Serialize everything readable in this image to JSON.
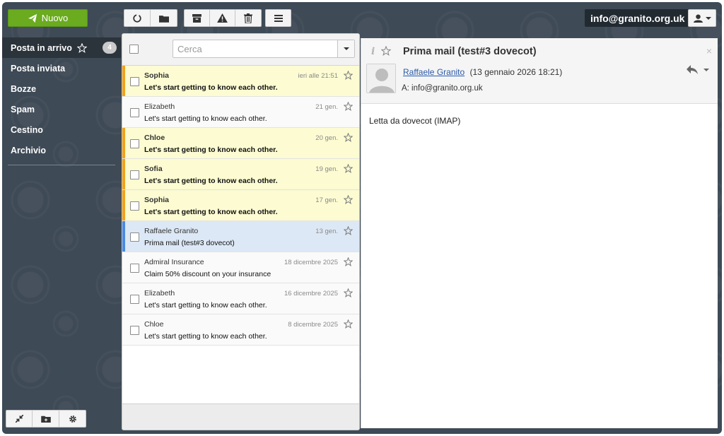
{
  "toolbar": {
    "new_label": "Nuovo",
    "account_label": "info@granito.org.uk",
    "icons": [
      "refresh-icon",
      "folder-move-icon",
      "archive-icon",
      "spam-icon",
      "trash-icon",
      "menu-icon"
    ]
  },
  "sidebar": {
    "items": [
      {
        "label": "Posta in arrivo",
        "badge": "4"
      },
      {
        "label": "Posta inviata"
      },
      {
        "label": "Bozze"
      },
      {
        "label": "Spam"
      },
      {
        "label": "Cestino"
      },
      {
        "label": "Archivio"
      }
    ]
  },
  "search": {
    "placeholder": "Cerca"
  },
  "messages": [
    {
      "from": "Sophia",
      "subject": "Let's start getting to know each other.",
      "date": "ieri alle 21:51"
    },
    {
      "from": "Elizabeth",
      "subject": "Let's start getting to know each other.",
      "date": "21 gen."
    },
    {
      "from": "Chloe",
      "subject": "Let's start getting to know each other.",
      "date": "20 gen."
    },
    {
      "from": "Sofia",
      "subject": "Let's start getting to know each other.",
      "date": "19 gen."
    },
    {
      "from": "Sophia",
      "subject": "Let's start getting to know each other.",
      "date": "17 gen."
    },
    {
      "from": "Raffaele Granito",
      "subject": "Prima mail (test#3 dovecot)",
      "date": "13 gen."
    },
    {
      "from": "Admiral Insurance",
      "subject": "Claim 50% discount on your insurance",
      "date": "18 dicembre 2025"
    },
    {
      "from": "Elizabeth",
      "subject": "Let's start getting to know each other.",
      "date": "16 dicembre 2025"
    },
    {
      "from": "Chloe",
      "subject": "Let's start getting to know each other.",
      "date": "8 dicembre 2025"
    }
  ],
  "reader": {
    "subject": "Prima mail (test#3 dovecot)",
    "info_glyph": "i",
    "from_name": "Raffaele Granito",
    "date": "(13 gennaio 2026 18:21)",
    "to": "A: info@granito.org.uk",
    "body": "Letta da dovecot (IMAP)",
    "close_glyph": "×"
  },
  "colors": {
    "accent_new": "#6aab1f",
    "unread_bg": "#fcfbd2",
    "unread_flag": "#f0a31c",
    "selected_bg": "#dde8f6",
    "selected_flag": "#4a8ae0",
    "sidebar_bg": "#3e4a56"
  }
}
